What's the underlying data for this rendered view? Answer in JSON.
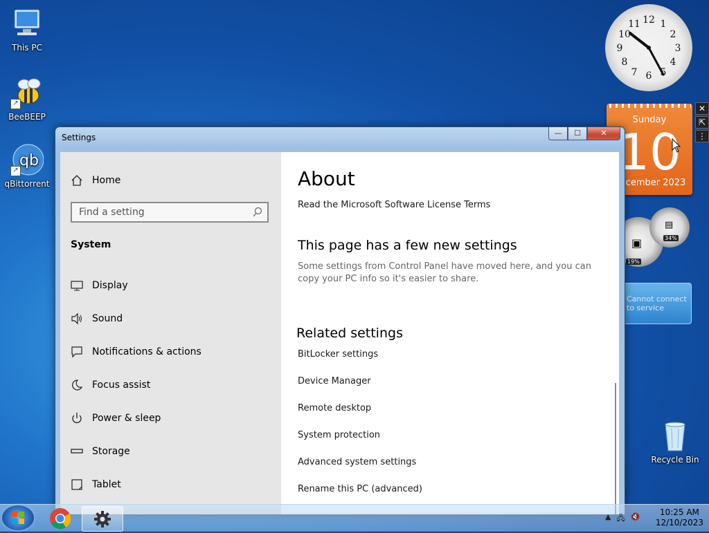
{
  "desktop": {
    "icons": [
      {
        "label": "This PC"
      },
      {
        "label": "BeeBEEP"
      },
      {
        "label": "qBittorrent"
      },
      {
        "label": "Recycle Bin"
      }
    ]
  },
  "gadgets": {
    "calendar": {
      "weekday": "Sunday",
      "day": "10",
      "month_year": "December 2023"
    },
    "cpu_meter": {
      "cpu": "19%",
      "memory": "34%"
    },
    "weather": {
      "message": "Cannot connect to service"
    }
  },
  "window": {
    "title": "Settings",
    "controls": {
      "minimize": "—",
      "maximize": "☐",
      "close": "✕"
    }
  },
  "nav": {
    "home": "Home",
    "search_placeholder": "Find a setting",
    "section": "System",
    "items": [
      {
        "label": "Display",
        "icon": "display-icon"
      },
      {
        "label": "Sound",
        "icon": "speaker-icon"
      },
      {
        "label": "Notifications & actions",
        "icon": "notification-icon"
      },
      {
        "label": "Focus assist",
        "icon": "moon-icon"
      },
      {
        "label": "Power & sleep",
        "icon": "power-icon"
      },
      {
        "label": "Storage",
        "icon": "storage-icon"
      },
      {
        "label": "Tablet",
        "icon": "tablet-icon"
      }
    ]
  },
  "main": {
    "title": "About",
    "license_link": "Read the Microsoft Software License Terms",
    "new_settings_heading": "This page has a few new settings",
    "new_settings_text": "Some settings from Control Panel have moved here, and you can copy your PC info so it's easier to share.",
    "related_heading": "Related settings",
    "related_links": [
      "BitLocker settings",
      "Device Manager",
      "Remote desktop",
      "System protection",
      "Advanced system settings",
      "Rename this PC (advanced)"
    ]
  },
  "taskbar": {
    "time": "10:25 AM",
    "date": "12/10/2023"
  }
}
